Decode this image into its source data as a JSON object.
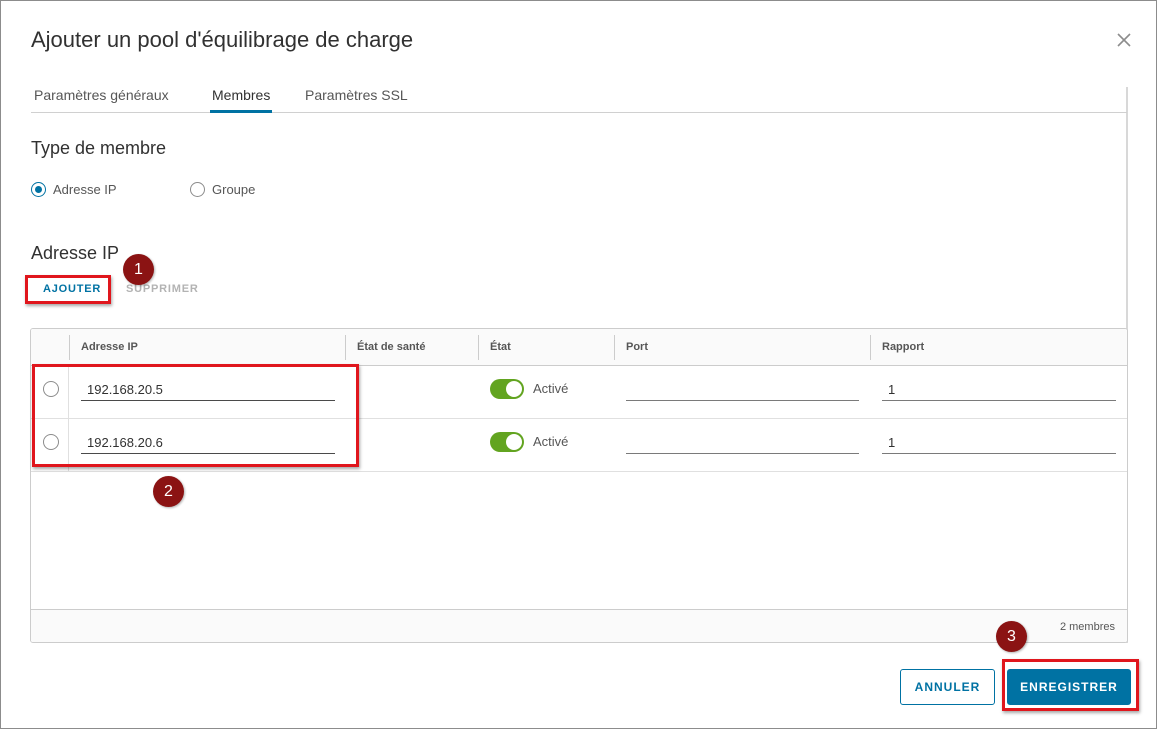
{
  "dialog": {
    "title": "Ajouter un pool d'équilibrage de charge"
  },
  "tabs": [
    {
      "label": "Paramètres généraux",
      "active": false
    },
    {
      "label": "Membres",
      "active": true
    },
    {
      "label": "Paramètres SSL",
      "active": false
    }
  ],
  "member_type": {
    "title": "Type de membre",
    "options": [
      {
        "label": "Adresse IP",
        "selected": true
      },
      {
        "label": "Groupe",
        "selected": false
      }
    ]
  },
  "ip_section": {
    "title": "Adresse IP",
    "add_label": "AJOUTER",
    "delete_label": "SUPPRIMER"
  },
  "grid": {
    "columns": [
      "Adresse IP",
      "État de santé",
      "État",
      "Port",
      "Rapport"
    ],
    "rows": [
      {
        "ip": "192.168.20.5",
        "state": "Activé",
        "enabled": true,
        "port": "",
        "ratio": "1"
      },
      {
        "ip": "192.168.20.6",
        "state": "Activé",
        "enabled": true,
        "port": "",
        "ratio": "1"
      }
    ],
    "footer": "2 membres"
  },
  "annotations": {
    "markers": [
      "1",
      "2",
      "3"
    ],
    "color": "#e0161d"
  },
  "footer": {
    "cancel_label": "ANNULER",
    "save_label": "ENREGISTRER"
  },
  "colors": {
    "accent": "#0072a3",
    "toggle_on": "#62a420",
    "marker": "#8b1313"
  }
}
